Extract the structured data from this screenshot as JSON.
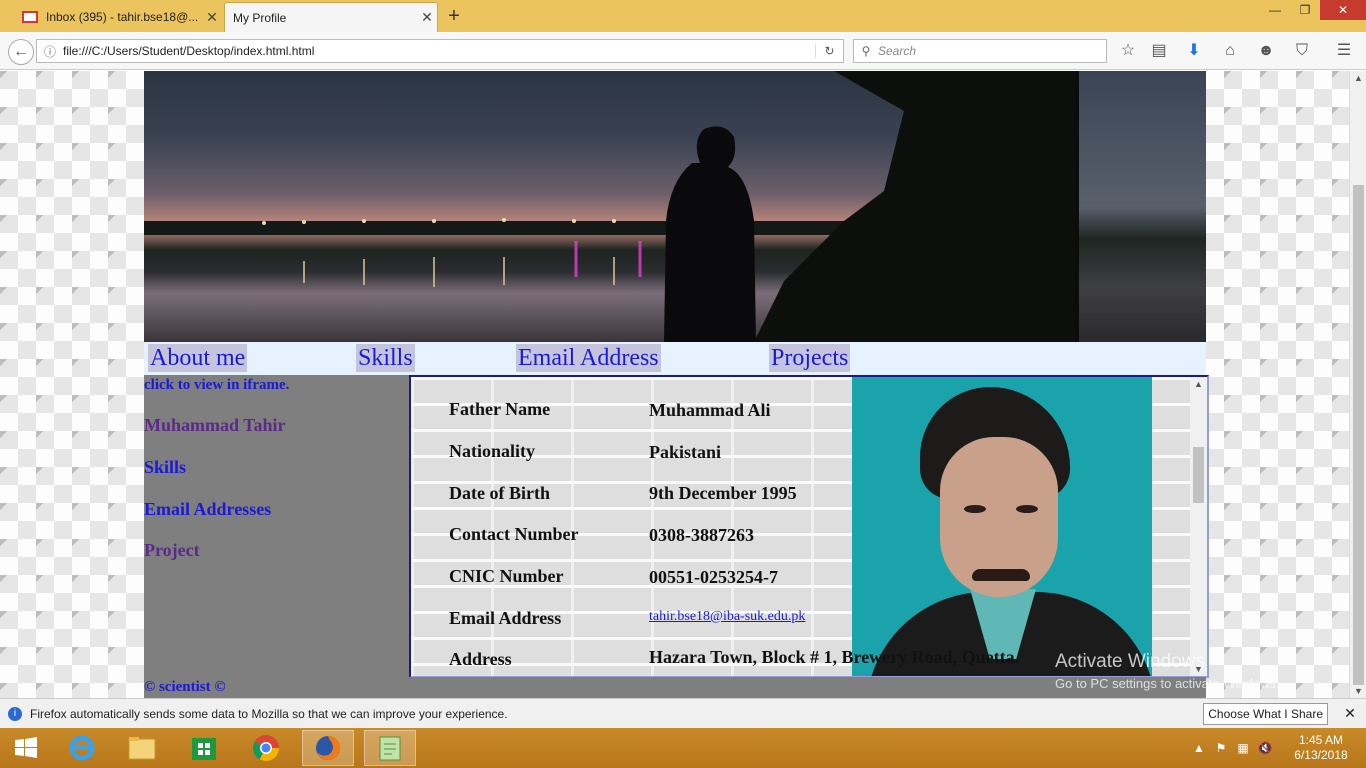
{
  "browser": {
    "tabs": [
      {
        "label": "Inbox (395) - tahir.bse18@...",
        "icon": "gmail-icon"
      },
      {
        "label": "My Profile"
      }
    ],
    "url": "file:///C:/Users/Student/Desktop/index.html.html",
    "search_placeholder": "Search"
  },
  "page": {
    "nav": [
      "About me",
      "Skills",
      "Email Address",
      "Projects"
    ],
    "sidebar": {
      "hint": "click to view in iframe.",
      "links": [
        "Muhammad Tahir",
        "Skills",
        "Email Addresses",
        "Project"
      ]
    },
    "profile": [
      {
        "label": "Father Name",
        "value": "Muhammad Ali"
      },
      {
        "label": "Nationality",
        "value": "Pakistani"
      },
      {
        "label": "Date of Birth",
        "value": "9th December 1995"
      },
      {
        "label": "Contact Number",
        "value": "0308-3887263"
      },
      {
        "label": "CNIC Number",
        "value": "00551-0253254-7"
      },
      {
        "label": "Email Address",
        "value": "tahir.bse18@iba-suk.edu.pk"
      },
      {
        "label": "Address",
        "value": "Hazara Town, Block # 1, Brewery Road, Quetta."
      }
    ],
    "footer": "© scientist ©"
  },
  "watermark": {
    "title": "Activate Windows",
    "sub": "Go to PC settings to activate Windows."
  },
  "notification": {
    "message": "Firefox automatically sends some data to Mozilla so that we can improve your experience.",
    "button": "Choose What I Share"
  },
  "taskbar": {
    "time": "1:45 AM",
    "date": "6/13/2018"
  },
  "colors": {
    "link": "#1a1ad6",
    "visited": "#5b2a86",
    "nav_bg": "#e6f2ff",
    "sidebar_bg": "#7f7f7f",
    "tabbar": "#ebc45e"
  }
}
